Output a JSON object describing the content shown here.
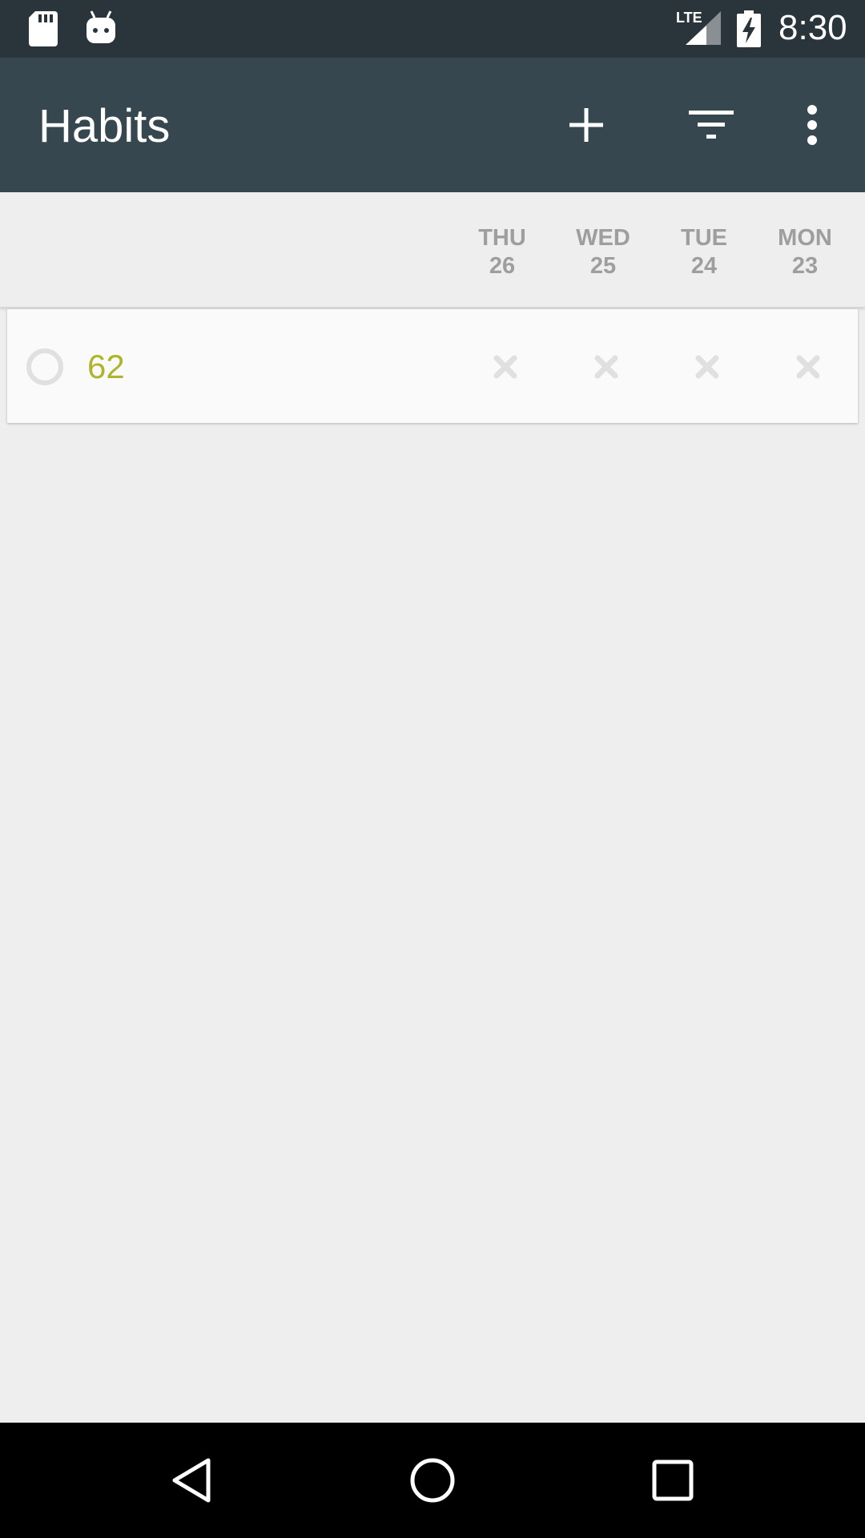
{
  "status_bar": {
    "time": "8:30",
    "network_label": "LTE",
    "icons": [
      "sd-card-icon",
      "android-icon",
      "lte-signal-icon",
      "battery-charging-icon"
    ]
  },
  "app_bar": {
    "title": "Habits",
    "actions": [
      "add-icon",
      "filter-icon",
      "more-vert-icon"
    ]
  },
  "day_header": {
    "days": [
      {
        "name": "THU",
        "num": "26"
      },
      {
        "name": "WED",
        "num": "25"
      },
      {
        "name": "TUE",
        "num": "24"
      },
      {
        "name": "MON",
        "num": "23"
      }
    ]
  },
  "habits": [
    {
      "name": "62",
      "color": "#afb42b",
      "checks": [
        "unchecked",
        "unchecked",
        "unchecked",
        "unchecked"
      ]
    }
  ],
  "nav_bar": {
    "buttons": [
      "back-icon",
      "home-icon",
      "recent-apps-icon"
    ]
  },
  "colors": {
    "status_bar": "#29343b",
    "app_bar": "#37474f",
    "background": "#eeeeee",
    "card": "#fafafa",
    "day_text": "#9e9e9e",
    "check_mark": "#e0e0e0"
  }
}
